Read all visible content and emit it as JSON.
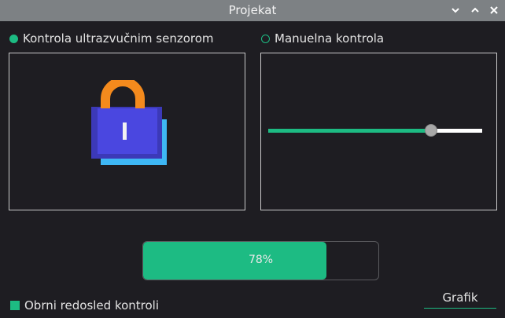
{
  "window": {
    "title": "Projekat",
    "controls": [
      "minimize-icon",
      "maximize-icon",
      "close-icon"
    ]
  },
  "modes": {
    "ultrasonic": {
      "label": "Kontrola ultrazvučnim senzorom",
      "selected": true
    },
    "manual": {
      "label": "Manuelna kontrola",
      "selected": false
    }
  },
  "left_panel": {
    "icon": "lock-icon"
  },
  "slider": {
    "value_fraction": 0.76
  },
  "progress": {
    "value": 0.78,
    "label": "78%"
  },
  "options": {
    "reverse_order": {
      "label": "Obrni redosled kontroli",
      "checked": true
    }
  },
  "tab": {
    "label": "Grafik"
  },
  "colors": {
    "accent": "#1dbb83",
    "titlebar": "#7d8184",
    "background": "#1e1d22",
    "lock_shackle": "#f48a1d",
    "lock_body": "#4a47e0",
    "lock_shadow": "#3eb7f5"
  }
}
